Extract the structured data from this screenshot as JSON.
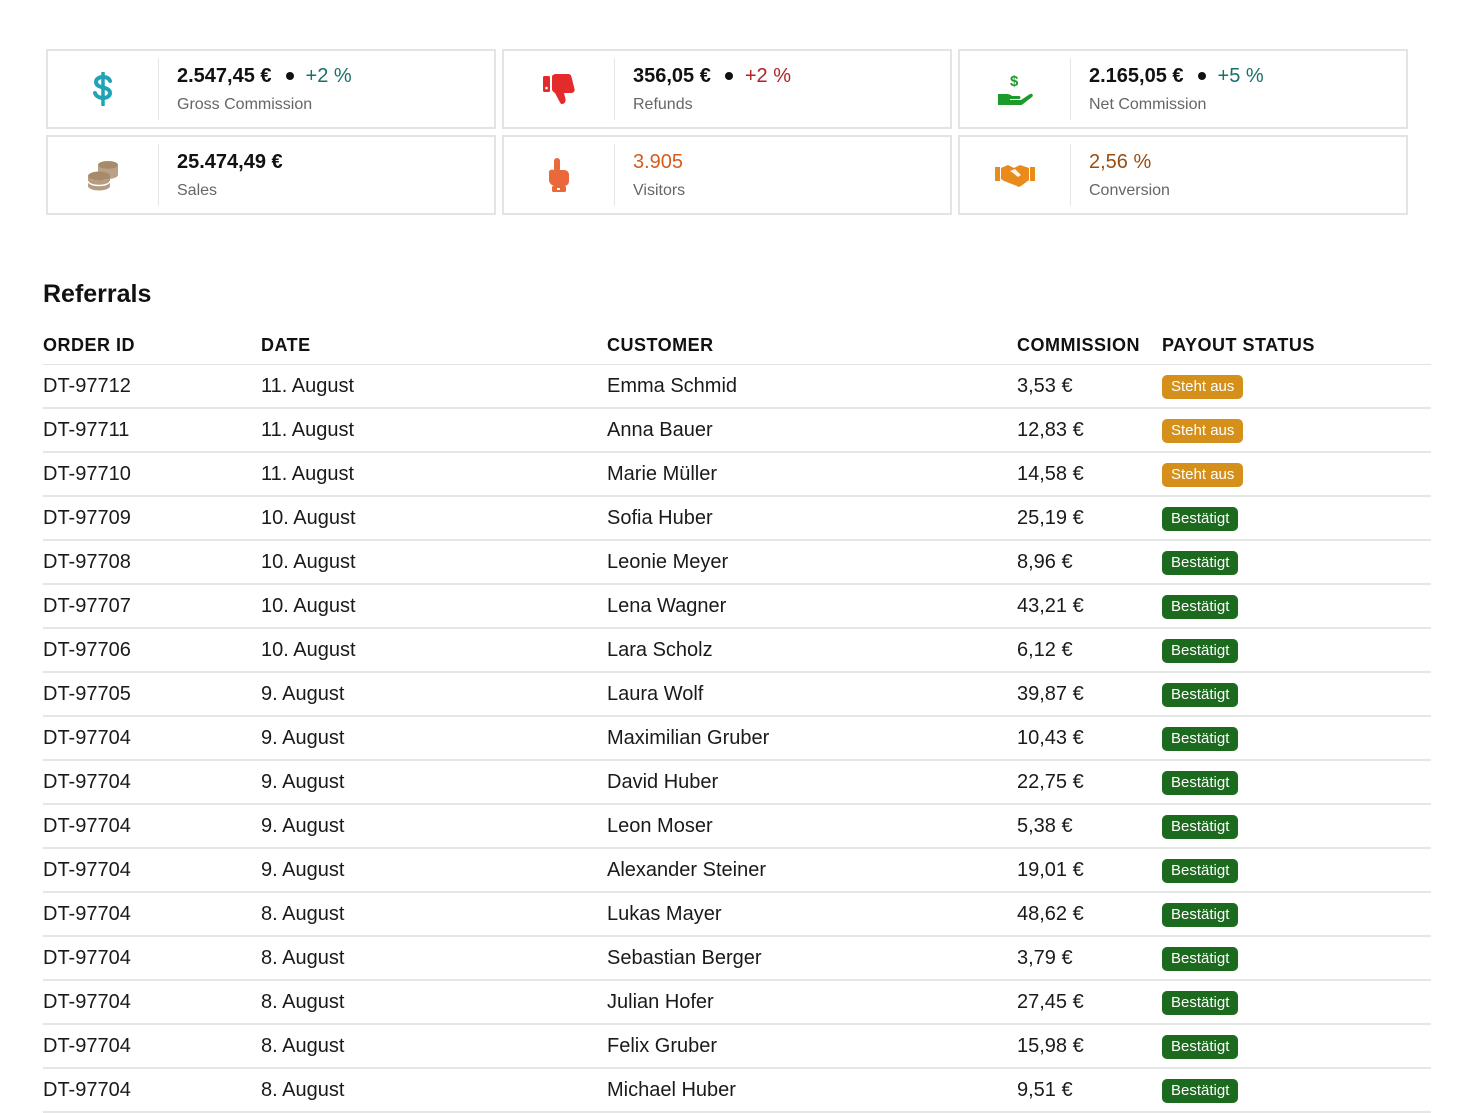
{
  "cards": [
    {
      "icon": "dollar-icon",
      "value": "2.547,45 €",
      "delta": "+2 %",
      "label": "Gross Commission",
      "icon_color": "#1fa3b5",
      "value_color": "#111111",
      "delta_color": "#17706b"
    },
    {
      "icon": "thumbs-down-icon",
      "value": "356,05 €",
      "delta": "+2 %",
      "label": "Refunds",
      "icon_color": "#e32b2b",
      "value_color": "#111111",
      "delta_color": "#b32222"
    },
    {
      "icon": "money-hand-icon",
      "value": "2.165,05 €",
      "delta": "+5 %",
      "label": "Net Commission",
      "icon_color": "#1c9a2b",
      "value_color": "#111111",
      "delta_color": "#17706b"
    },
    {
      "icon": "coins-icon",
      "value": "25.474,49 €",
      "delta": "",
      "label": "Sales",
      "icon_color": "#a88a6a",
      "value_color": "#111111",
      "delta_color": ""
    },
    {
      "icon": "pointing-hand-icon",
      "value": "3.905",
      "delta": "",
      "label": "Visitors",
      "icon_color": "#e9693a",
      "value_color": "#d65c1e",
      "delta_color": ""
    },
    {
      "icon": "handshake-icon",
      "value": "2,56 %",
      "delta": "",
      "label": "Conversion",
      "icon_color": "#e98a1a",
      "value_color": "#9a4d10",
      "delta_color": ""
    }
  ],
  "referrals": {
    "title": "Referrals",
    "columns": [
      "ORDER ID",
      "DATE",
      "CUSTOMER",
      "COMMISSION",
      "PAYOUT STATUS"
    ],
    "rows": [
      {
        "order_id": "DT-97712",
        "date": "11. August",
        "customer": "Emma Schmid",
        "commission": "3,53 €",
        "status": "Steht aus",
        "status_type": "pending"
      },
      {
        "order_id": "DT-97711",
        "date": "11. August",
        "customer": "Anna Bauer",
        "commission": "12,83 €",
        "status": "Steht aus",
        "status_type": "pending"
      },
      {
        "order_id": "DT-97710",
        "date": "11. August",
        "customer": "Marie Müller",
        "commission": "14,58 €",
        "status": "Steht aus",
        "status_type": "pending"
      },
      {
        "order_id": "DT-97709",
        "date": "10. August",
        "customer": "Sofia Huber",
        "commission": "25,19 €",
        "status": "Bestätigt",
        "status_type": "ok"
      },
      {
        "order_id": "DT-97708",
        "date": "10. August",
        "customer": "Leonie Meyer",
        "commission": "8,96 €",
        "status": "Bestätigt",
        "status_type": "ok"
      },
      {
        "order_id": "DT-97707",
        "date": "10. August",
        "customer": "Lena Wagner",
        "commission": "43,21 €",
        "status": "Bestätigt",
        "status_type": "ok"
      },
      {
        "order_id": "DT-97706",
        "date": "10. August",
        "customer": "Lara Scholz",
        "commission": "6,12 €",
        "status": "Bestätigt",
        "status_type": "ok"
      },
      {
        "order_id": "DT-97705",
        "date": "9. August",
        "customer": "Laura Wolf",
        "commission": "39,87 €",
        "status": "Bestätigt",
        "status_type": "ok"
      },
      {
        "order_id": "DT-97704",
        "date": "9. August",
        "customer": "Maximilian Gruber",
        "commission": "10,43 €",
        "status": "Bestätigt",
        "status_type": "ok"
      },
      {
        "order_id": "DT-97704",
        "date": "9. August",
        "customer": "David Huber",
        "commission": "22,75 €",
        "status": "Bestätigt",
        "status_type": "ok"
      },
      {
        "order_id": "DT-97704",
        "date": "9. August",
        "customer": "Leon Moser",
        "commission": "5,38 €",
        "status": "Bestätigt",
        "status_type": "ok"
      },
      {
        "order_id": "DT-97704",
        "date": "9. August",
        "customer": "Alexander Steiner",
        "commission": "19,01 €",
        "status": "Bestätigt",
        "status_type": "ok"
      },
      {
        "order_id": "DT-97704",
        "date": "8. August",
        "customer": "Lukas Mayer",
        "commission": "48,62 €",
        "status": "Bestätigt",
        "status_type": "ok"
      },
      {
        "order_id": "DT-97704",
        "date": "8. August",
        "customer": "Sebastian Berger",
        "commission": "3,79 €",
        "status": "Bestätigt",
        "status_type": "ok"
      },
      {
        "order_id": "DT-97704",
        "date": "8. August",
        "customer": "Julian Hofer",
        "commission": "27,45 €",
        "status": "Bestätigt",
        "status_type": "ok"
      },
      {
        "order_id": "DT-97704",
        "date": "8. August",
        "customer": "Felix Gruber",
        "commission": "15,98 €",
        "status": "Bestätigt",
        "status_type": "ok"
      },
      {
        "order_id": "DT-97704",
        "date": "8. August",
        "customer": "Michael Huber",
        "commission": "9,51 €",
        "status": "Bestätigt",
        "status_type": "ok"
      }
    ]
  }
}
